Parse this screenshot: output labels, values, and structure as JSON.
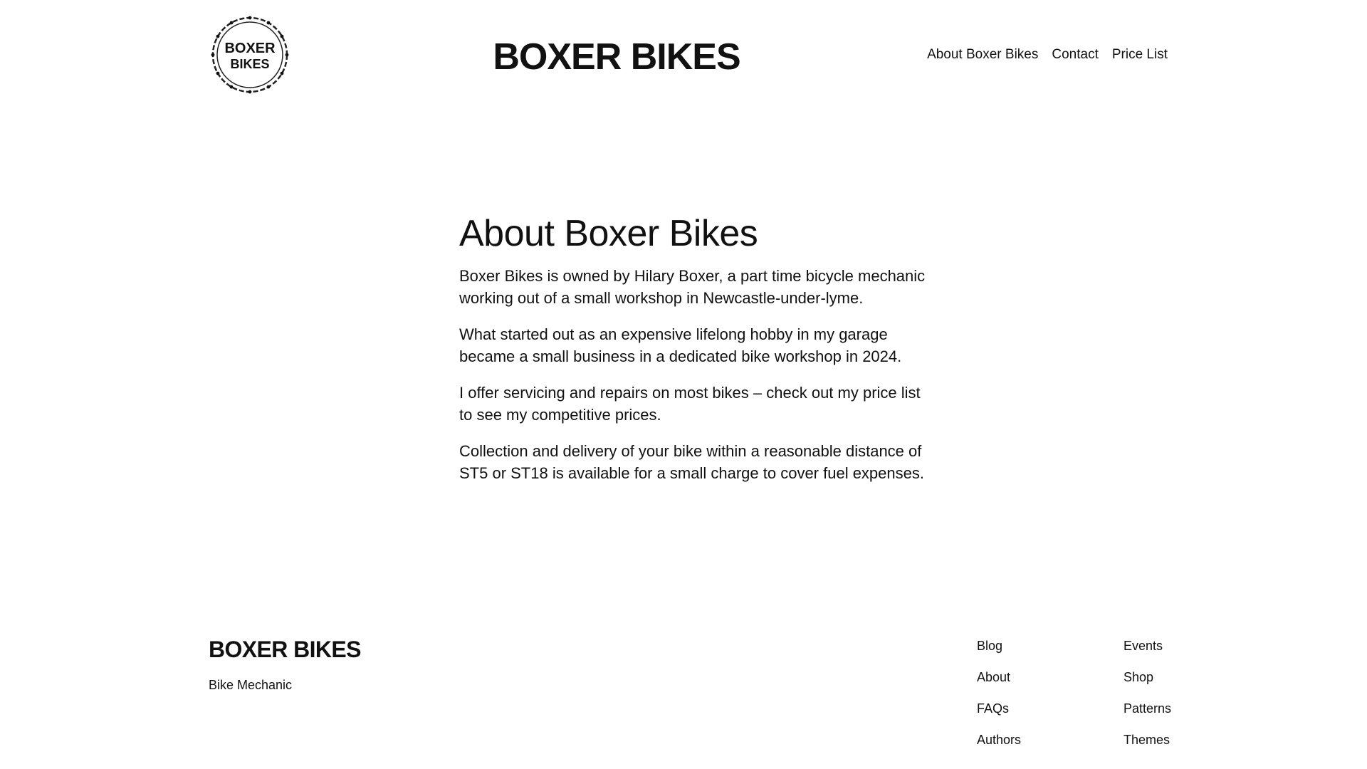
{
  "header": {
    "logo_text_top": "BOXER",
    "logo_text_bottom": "BIKES",
    "site_title": "BOXER BIKES",
    "nav": [
      {
        "label": "About Boxer Bikes"
      },
      {
        "label": "Contact"
      },
      {
        "label": "Price List"
      }
    ]
  },
  "main": {
    "heading": "About Boxer Bikes",
    "paragraphs": [
      "Boxer Bikes is owned by Hilary Boxer, a part time bicycle mechanic working out of a small workshop in Newcastle-under-lyme.",
      "What started out as an expensive lifelong hobby in my garage became a small business in a dedicated bike workshop in 2024.",
      "I offer servicing and repairs on most bikes – check out my price list to see my competitive prices.",
      "Collection and delivery of your bike within a reasonable distance of ST5 or ST18 is available for a small charge to cover fuel expenses."
    ]
  },
  "footer": {
    "brand": "BOXER BIKES",
    "tagline": "Bike Mechanic",
    "col1": [
      {
        "label": "Blog"
      },
      {
        "label": "About"
      },
      {
        "label": "FAQs"
      },
      {
        "label": "Authors"
      }
    ],
    "col2": [
      {
        "label": "Events"
      },
      {
        "label": "Shop"
      },
      {
        "label": "Patterns"
      },
      {
        "label": "Themes"
      }
    ]
  },
  "colors": {
    "text": "#111111",
    "background": "#ffffff"
  }
}
